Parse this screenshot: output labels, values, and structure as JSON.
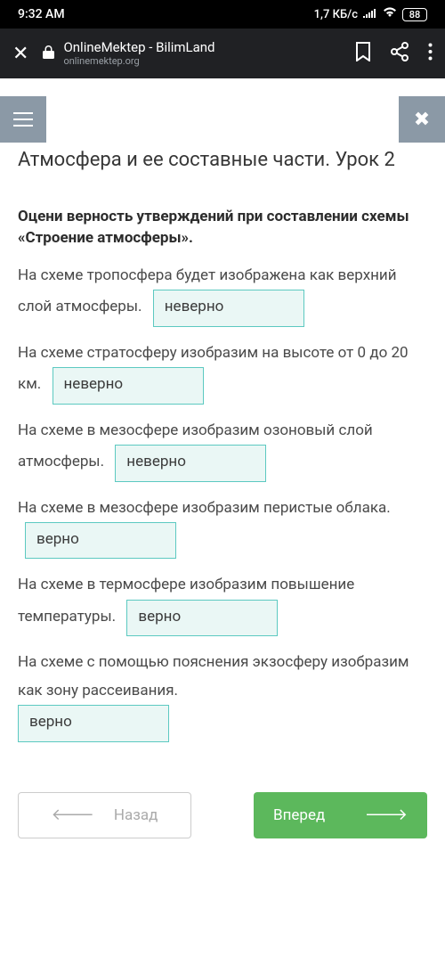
{
  "status": {
    "time": "9:32 AM",
    "data": "1,7 КБ/с",
    "battery": "88"
  },
  "browser": {
    "title": "OnlineMektep - BilimLand",
    "domain": "onlinemektep.org"
  },
  "page": {
    "title": "Атмосфера и ее составные части. Урок 2",
    "instruction": "Оцени верность утверждений при составлении схемы «Строение атмосферы».",
    "tasks": [
      {
        "text_before": "На схеме тропосфера будет изображена как верхний слой атмосферы.",
        "answer": "неверно",
        "text_after": ""
      },
      {
        "text_before": "На схеме стратосферу изобразим на высоте от 0 до 20 км.",
        "answer": "неверно",
        "text_after": ""
      },
      {
        "text_before": "На схеме в мезосфере изобразим озоновый слой атмосферы.",
        "answer": "неверно",
        "text_after": ""
      },
      {
        "text_before": "На схеме в мезосфере изобразим перистые облака.",
        "answer": "верно",
        "text_after": ""
      },
      {
        "text_before": "На схеме в термосфере изобразим повышение температуры.",
        "answer": "верно",
        "text_after": ""
      },
      {
        "text_before": "На схеме с помощью пояснения экзосферу изобразим как зону рассеивания.",
        "answer": "верно",
        "text_after": ""
      }
    ],
    "nav": {
      "back": "Назад",
      "forward": "Вперед"
    }
  }
}
